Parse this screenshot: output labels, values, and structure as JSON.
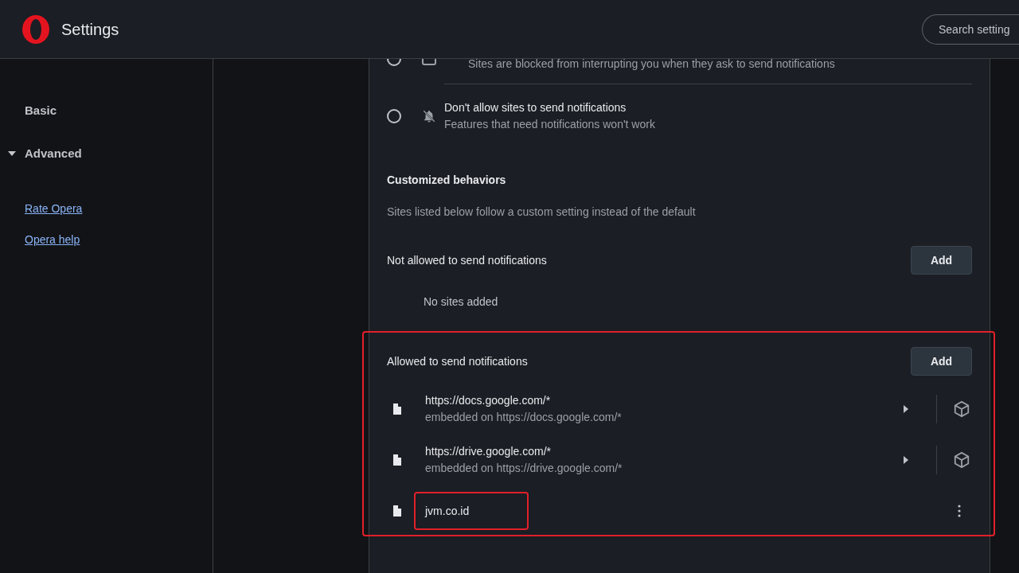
{
  "header": {
    "title": "Settings",
    "search": {
      "placeholder": "Search setting"
    }
  },
  "sidebar": {
    "items": [
      {
        "label": "Basic",
        "expanded": false
      },
      {
        "label": "Advanced",
        "expanded": true
      }
    ],
    "links": [
      "Rate Opera",
      "Opera help"
    ]
  },
  "options": [
    {
      "description": "Sites are blocked from interrupting you when they ask to send notifications",
      "selected": false
    },
    {
      "title": "Don't allow sites to send notifications",
      "description": "Features that need notifications won't work",
      "selected": false
    }
  ],
  "customized": {
    "title": "Customized behaviors",
    "description": "Sites listed below follow a custom setting instead of the default"
  },
  "blocked": {
    "title": "Not allowed to send notifications",
    "button": "Add",
    "empty": "No sites added",
    "highlighted": false
  },
  "allowed": {
    "title": "Allowed to send notifications",
    "button": "Add",
    "highlighted": true,
    "sites": [
      {
        "url": "https://docs.google.com/*",
        "embedded": "embedded on https://docs.google.com/*",
        "kind": "embedded",
        "highlighted": false
      },
      {
        "url": "https://drive.google.com/*",
        "embedded": "embedded on https://drive.google.com/*",
        "kind": "embedded",
        "highlighted": false
      },
      {
        "url": "jvm.co.id",
        "kind": "plain",
        "highlighted": true
      }
    ]
  }
}
